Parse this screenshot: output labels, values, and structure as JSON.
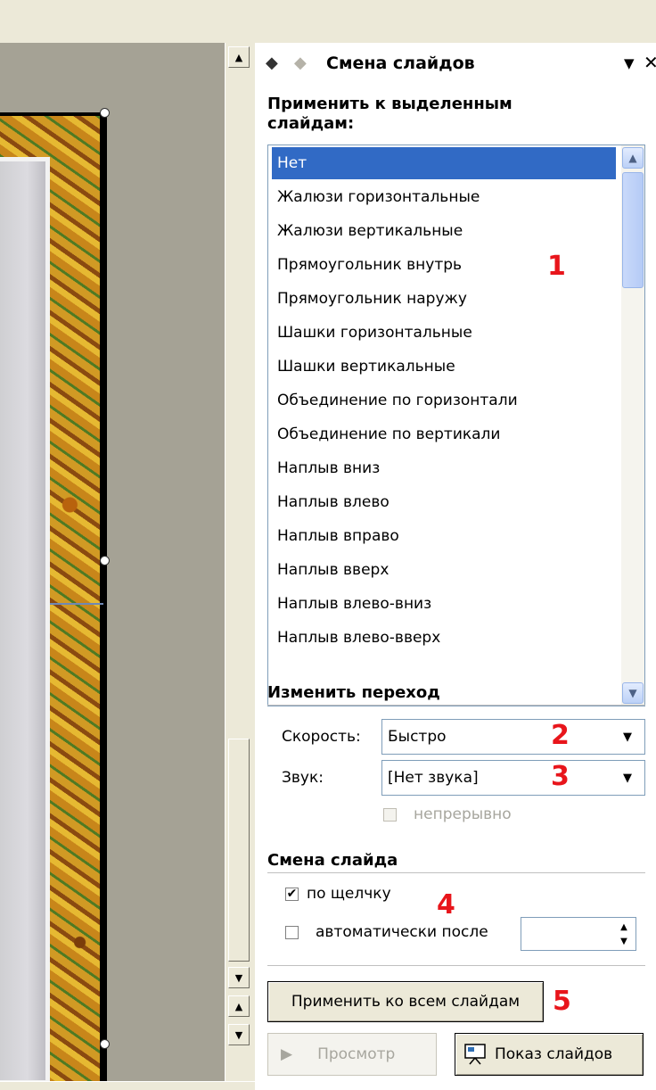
{
  "pane": {
    "title": "Смена слайдов",
    "back_icon": "back-arrow-icon",
    "forward_icon": "forward-arrow-icon",
    "close_icon": "close-icon",
    "dropdown_icon": "pane-menu-icon"
  },
  "apply_section": {
    "label": "Применить к выделенным слайдам:",
    "items": [
      "Нет",
      "Жалюзи горизонтальные",
      "Жалюзи вертикальные",
      "Прямоугольник внутрь",
      "Прямоугольник наружу",
      "Шашки горизонтальные",
      "Шашки вертикальные",
      "Объединение по горизонтали",
      "Объединение по вертикали",
      "Наплыв вниз",
      "Наплыв влево",
      "Наплыв вправо",
      "Наплыв вверх",
      "Наплыв влево-вниз",
      "Наплыв влево-вверх"
    ],
    "selected_index": 0
  },
  "modify_section": {
    "label": "Изменить переход",
    "speed_label": "Скорость:",
    "speed_value": "Быстро",
    "sound_label": "Звук:",
    "sound_value": "[Нет звука]",
    "loop_label": "непрерывно",
    "loop_checked": false,
    "loop_enabled": false
  },
  "advance_section": {
    "label": "Смена слайда",
    "on_click_label": "по щелчку",
    "on_click_checked": true,
    "auto_label": "автоматически после",
    "auto_checked": false,
    "auto_value": ""
  },
  "buttons": {
    "apply_all": "Применить ко всем слайдам",
    "preview": "Просмотр",
    "slideshow": "Показ слайдов"
  },
  "annotations": [
    "1",
    "2",
    "3",
    "4",
    "5"
  ],
  "colors": {
    "selection": "#316ac5",
    "annotation": "#e8151b",
    "workspace": "#a5a295"
  }
}
